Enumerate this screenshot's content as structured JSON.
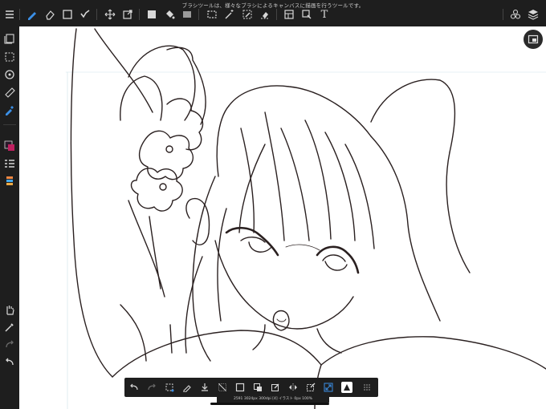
{
  "status": {
    "hint_text": "ブラシツールは、様々なブラシによるキャンバスに描画を行うツールです。",
    "bottom_tip": "2591 3024px 300dpi [4] イラスト 0px 100%"
  },
  "toolbar": {
    "text_tool_label": "T"
  },
  "colors": {
    "bar_bg": "#1e1e1e",
    "icon": "#d8d8d8",
    "active_icon": "#3b8fe6",
    "canvas_bg": "#ffffff",
    "line_art": "#2a2020"
  },
  "icons": {
    "top_left": [
      "menu-icon",
      "brush-icon",
      "eraser-icon",
      "rectangle-icon",
      "smudge-icon",
      "move-icon",
      "transform-icon",
      "fill-color-icon",
      "bucket-icon",
      "gradient-icon",
      "selection-icon",
      "magic-wand-icon",
      "pen-select-icon",
      "eraser-select-icon",
      "frame-icon",
      "export-icon",
      "text-icon"
    ],
    "top_right": [
      "materials-icon",
      "layers-icon"
    ],
    "sidebar": [
      "layers-icon",
      "selection-icon",
      "rotate-icon",
      "ruler-icon",
      "eyedropper-icon",
      "color-icon",
      "layer-list-icon",
      "palette-icon",
      "hand-icon",
      "eyedropper-icon",
      "redo-icon",
      "undo-icon"
    ],
    "bottom": [
      "undo-icon",
      "redo-icon",
      "transform-icon",
      "pen-icon",
      "save-icon",
      "clear-icon",
      "invert-icon",
      "select-icon",
      "edit-icon",
      "flip-icon",
      "select-all-icon",
      "fit-icon",
      "view-icon",
      "more-icon"
    ]
  }
}
